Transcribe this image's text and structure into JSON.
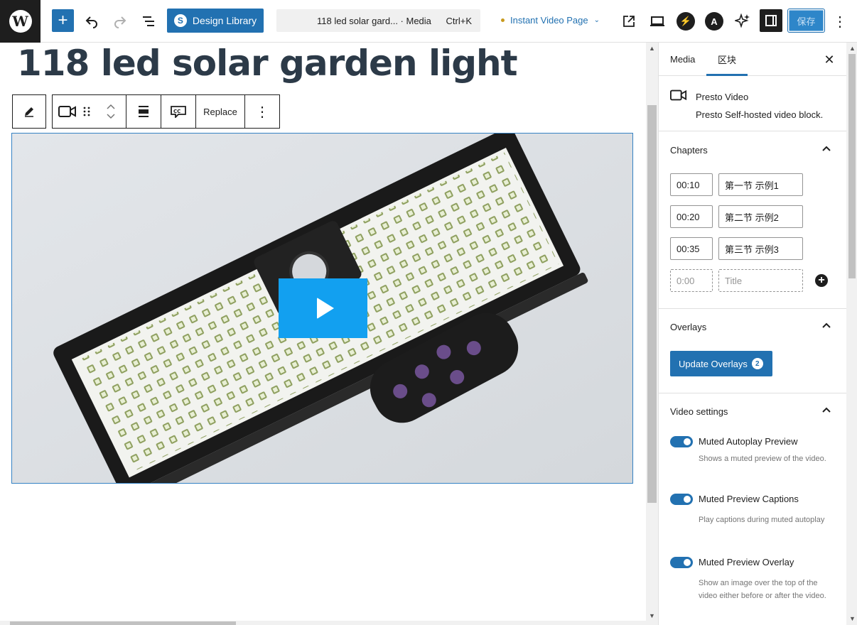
{
  "topbar": {
    "logo": "W",
    "add_symbol": "+",
    "design_library_label": "Design Library",
    "command": {
      "title": "118 led solar gard... · Media",
      "shortcut": "Ctrl+K"
    },
    "template_label": "Instant Video Page",
    "save_label": "保存"
  },
  "canvas": {
    "page_title": "118 led solar garden light",
    "toolbar": {
      "replace_label": "Replace"
    }
  },
  "panel": {
    "tabs": [
      {
        "label": "Media"
      },
      {
        "label": "区块"
      }
    ],
    "active_tab": "区块",
    "block": {
      "title": "Presto Video",
      "description": "Presto Self-hosted video block."
    },
    "chapters": {
      "title": "Chapters",
      "items": [
        {
          "time": "00:10",
          "title": "第一节 示例1"
        },
        {
          "time": "00:20",
          "title": "第二节 示例2"
        },
        {
          "time": "00:35",
          "title": "第三节 示例3"
        }
      ],
      "new_time_placeholder": "0:00",
      "new_title_placeholder": "Title"
    },
    "overlays": {
      "title": "Overlays",
      "button_label": "Update Overlays",
      "count": "2"
    },
    "video_settings": {
      "title": "Video settings",
      "toggles": [
        {
          "label": "Muted Autoplay Preview",
          "help": "Shows a muted preview of the video.",
          "checked": true
        },
        {
          "label": "Muted Preview Captions",
          "help": "Play captions during muted autoplay",
          "checked": true
        },
        {
          "label": "Muted Preview Overlay",
          "help": "Show an image over the top of the video either before or after the video.",
          "checked": true
        }
      ]
    }
  },
  "colors": {
    "accent": "#2271b1",
    "play_button": "#12a0f0",
    "dark": "#1e1e1e"
  }
}
